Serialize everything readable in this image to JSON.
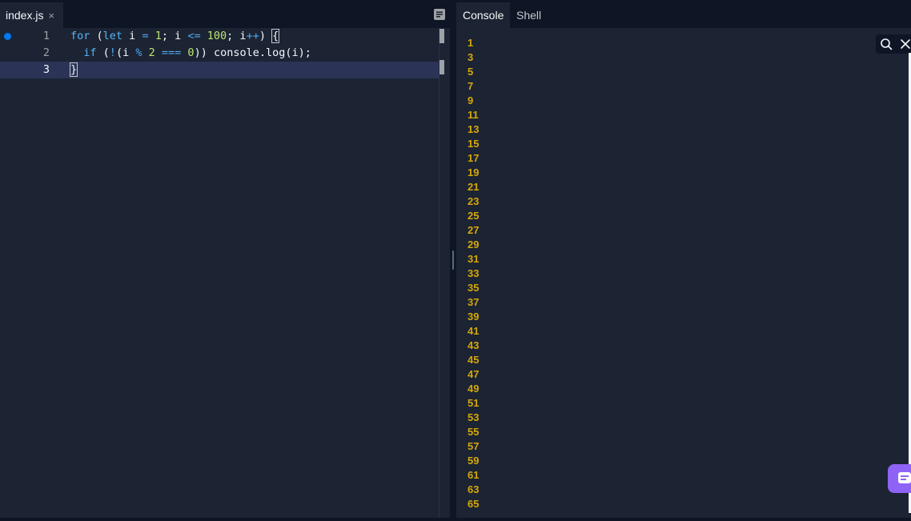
{
  "editor": {
    "file_tab": {
      "label": "index.js",
      "close": "×"
    },
    "code_lines": [
      {
        "number": "1"
      },
      {
        "number": "2"
      },
      {
        "number": "3"
      }
    ],
    "code_tokens": {
      "l1_for": "for",
      "l1_paren": " (",
      "l1_let": "let",
      "l1_i": " i ",
      "l1_eq": "=",
      "l1_sp": " ",
      "l1_one": "1",
      "l1_semi": "; i ",
      "l1_le": "<=",
      "l1_sp2": " ",
      "l1_hundred": "100",
      "l1_semi2": "; i",
      "l1_inc": "++",
      "l1_close": ") ",
      "l1_brace": "{",
      "l2_indent": "  ",
      "l2_if": "if",
      "l2_open": " (",
      "l2_not": "!",
      "l2_i": "(i ",
      "l2_mod": "%",
      "l2_sp": " ",
      "l2_two": "2",
      "l2_sp2": " ",
      "l2_eqq": "===",
      "l2_sp3": " ",
      "l2_zero": "0",
      "l2_rest": ")) console.",
      "l2_log": "log",
      "l2_end": "(i);",
      "l3_brace": "}"
    }
  },
  "console": {
    "tabs": [
      {
        "label": "Console",
        "active": true
      },
      {
        "label": "Shell",
        "active": false
      }
    ],
    "output": [
      "1",
      "3",
      "5",
      "7",
      "9",
      "11",
      "13",
      "15",
      "17",
      "19",
      "21",
      "23",
      "25",
      "27",
      "29",
      "31",
      "33",
      "35",
      "37",
      "39",
      "41",
      "43",
      "45",
      "47",
      "49",
      "51",
      "53",
      "55",
      "57",
      "59",
      "61",
      "63",
      "65"
    ]
  },
  "icons": {
    "layout": "layout-icon",
    "search": "search-icon",
    "close": "close-icon",
    "chat": "chat-icon"
  },
  "colors": {
    "background": "#1c2333",
    "chrome": "#0e1525",
    "active_line": "#2b3356",
    "output_text": "#d4a809",
    "keyword": "#56b6f4",
    "number": "#bde66d",
    "breakpoint": "#0079f2",
    "chat_button": "#8f63f5"
  }
}
